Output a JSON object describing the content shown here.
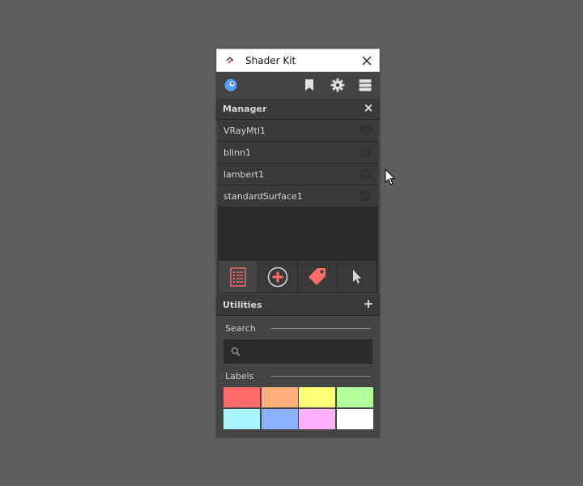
{
  "window": {
    "title": "Shader Kit",
    "accent": "#4ea3ff"
  },
  "toolbar": {
    "icons": [
      "shader-ball-icon",
      "bookmark-icon",
      "gear-icon",
      "database-icon"
    ]
  },
  "manager": {
    "title": "Manager",
    "close_symbol": "×",
    "items": [
      {
        "label": "VRayMtl1"
      },
      {
        "label": "blinn1"
      },
      {
        "label": "lambert1"
      },
      {
        "label": "standardSurface1"
      }
    ],
    "tools": [
      "list-icon",
      "add-circle-icon",
      "tag-icon",
      "pointer-icon"
    ],
    "tool_accent": "#ff6b6b"
  },
  "utilities": {
    "title": "Utilities",
    "add_symbol": "+",
    "search_label": "Search",
    "search_placeholder": "",
    "labels_label": "Labels",
    "label_colors": [
      "#ff6b6b",
      "#ffb07a",
      "#ffff78",
      "#b2ff9c",
      "#a6f5ff",
      "#8cb2ff",
      "#ffb0ff",
      "#ffffff"
    ]
  }
}
